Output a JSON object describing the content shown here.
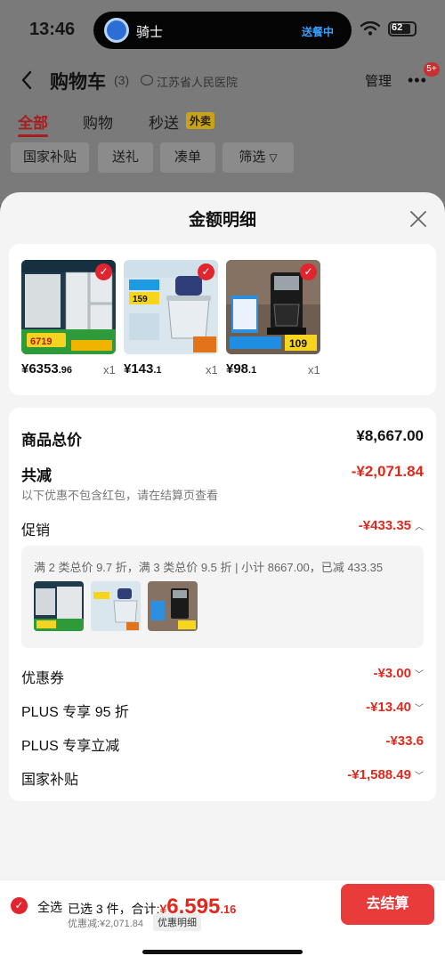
{
  "status_bar": {
    "time": "13:46",
    "island_title": "骑士",
    "island_status": "送餐中",
    "battery_level": "62"
  },
  "nav": {
    "title": "购物车",
    "count": "(3)",
    "location": "江苏省人民医院",
    "manage": "管理",
    "badge": "5+"
  },
  "tabs": [
    {
      "label": "全部"
    },
    {
      "label": "购物"
    },
    {
      "label": "秒送"
    }
  ],
  "tab_tag": "外卖",
  "chips": [
    {
      "label": "国家补贴"
    },
    {
      "label": "送礼"
    },
    {
      "label": "凑单"
    },
    {
      "label": "筛选"
    }
  ],
  "sheet": {
    "title": "金额明细",
    "products": [
      {
        "price_main": "¥6353",
        "price_cents": ".96",
        "qty": "x1",
        "icon": "refrigerator-image"
      },
      {
        "price_main": "¥143",
        "price_cents": ".1",
        "qty": "x1",
        "icon": "food-chopper-image"
      },
      {
        "price_main": "¥98",
        "price_cents": ".1",
        "qty": "x1",
        "icon": "coffee-maker-image"
      }
    ],
    "total_label": "商品总价",
    "total_value": "¥8,667.00",
    "reduce_label": "共减",
    "reduce_value": "-¥2,071.84",
    "reduce_note": "以下优惠不包含红包，请在结算页查看",
    "promo_label": "促销",
    "promo_value": "-¥433.35",
    "promo_text": "满 2 类总价 9.7 折，满 3 类总价 9.5 折 | 小计 8667.00，已减 433.35",
    "rows": [
      {
        "label": "优惠券",
        "value": "-¥3.00",
        "chevron": true
      },
      {
        "label": "PLUS 专享 95 折",
        "value": "-¥13.40",
        "chevron": true
      },
      {
        "label": "PLUS 专享立减",
        "value": "-¥33.6",
        "chevron": false
      },
      {
        "label": "国家补贴",
        "value": "-¥1,588.49",
        "chevron": true
      }
    ]
  },
  "bottom_bar": {
    "select_all": "全选",
    "summary_prefix": "已选 3 件，合计:",
    "total_symbol": "¥",
    "total_main": "6,595",
    "total_cents": ".16",
    "discount_line": "优惠减:¥2,071.84",
    "detail_tag": "优惠明细",
    "checkout": "去结算"
  },
  "colors": {
    "accent_red": "#e1281c",
    "button_red": "#ea3b3b",
    "sheet_bg": "#f4f4f4"
  }
}
